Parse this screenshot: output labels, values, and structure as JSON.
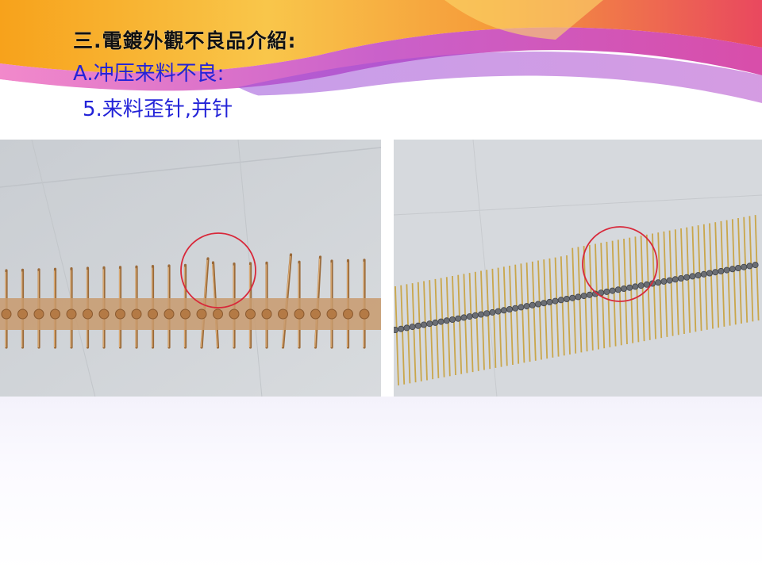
{
  "slide": {
    "title": "三.電鍍外觀不良品介紹:",
    "subtitle": "A.冲压来料不良:",
    "item": "5.来料歪针,并针"
  },
  "photos": [
    {
      "name": "bent-pin-strip-copper",
      "highlight_color": "#d8283a"
    },
    {
      "name": "bent-pin-strip-gold",
      "highlight_color": "#d8283a"
    }
  ]
}
